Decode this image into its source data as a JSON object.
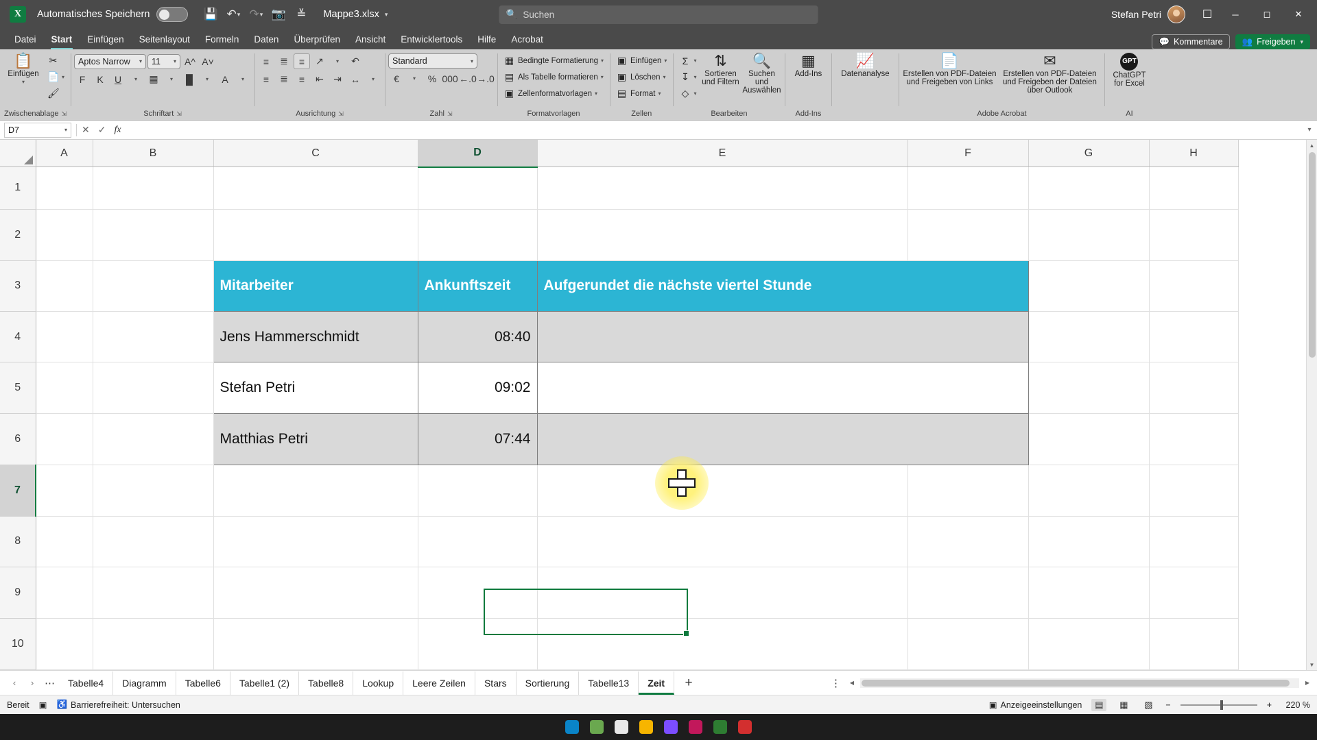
{
  "titlebar": {
    "autosave_label": "Automatisches Speichern",
    "autosave_state": "off",
    "save_icon": "save-icon",
    "undo_icon": "undo-icon",
    "redo_icon": "redo-icon",
    "camera_icon": "camera-icon",
    "customize_icon": "chevron-down-icon",
    "filename": "Mappe3.xlsx",
    "search_placeholder": "Suchen",
    "user_name": "Stefan Petri",
    "minimize": "minimize-icon",
    "maximize": "maximize-icon",
    "close": "close-icon"
  },
  "ribbon_tabs": [
    {
      "label": "Datei",
      "active": false
    },
    {
      "label": "Start",
      "active": true
    },
    {
      "label": "Einfügen",
      "active": false
    },
    {
      "label": "Seitenlayout",
      "active": false
    },
    {
      "label": "Formeln",
      "active": false
    },
    {
      "label": "Daten",
      "active": false
    },
    {
      "label": "Überprüfen",
      "active": false
    },
    {
      "label": "Ansicht",
      "active": false
    },
    {
      "label": "Entwicklertools",
      "active": false
    },
    {
      "label": "Hilfe",
      "active": false
    },
    {
      "label": "Acrobat",
      "active": false
    }
  ],
  "ribbon_right": {
    "comments_label": "Kommentare",
    "share_label": "Freigeben"
  },
  "ribbon": {
    "clipboard": {
      "group_label": "Zwischenablage",
      "paste_label": "Einfügen",
      "cut_label": "Ausschneiden",
      "copy_label": "Kopieren",
      "format_painter_label": "Format übertragen"
    },
    "font": {
      "group_label": "Schriftart",
      "font_name": "Aptos Narrow",
      "font_size": "11",
      "grow_label": "Schriftgrad vergrößern",
      "shrink_label": "Schriftgrad verkleinern",
      "bold_label": "F",
      "italic_label": "K",
      "underline_label": "U",
      "borders_label": "Rahmen",
      "fill_label": "Füllfarbe",
      "fontcolor_label": "Schriftfarbe"
    },
    "alignment": {
      "group_label": "Ausrichtung",
      "wrap_label": "Textumbruch",
      "merge_label": "Verbinden und zentrieren"
    },
    "number": {
      "group_label": "Zahl",
      "format_value": "Standard",
      "currency_label": "Buchhaltungszahlenformat",
      "percent_label": "Prozentformat",
      "thousands_label": "1000er-Trennzeichen",
      "inc_dec_label": "Dezimalstelle hinzufügen",
      "dec_dec_label": "Dezimalstelle löschen"
    },
    "styles": {
      "group_label": "Formatvorlagen",
      "items": [
        "Bedingte Formatierung",
        "Als Tabelle formatieren",
        "Zellenformatvorlagen"
      ]
    },
    "cells": {
      "group_label": "Zellen",
      "items": [
        "Einfügen",
        "Löschen",
        "Format"
      ]
    },
    "editing": {
      "group_label": "Bearbeiten",
      "autosum_label": "AutoSumme",
      "fill_label": "Füllbereich",
      "clear_label": "Löschen",
      "sort_label": "Sortieren und Filtern",
      "find_label": "Suchen und Auswählen"
    },
    "addins": {
      "group_label": "Add-Ins",
      "button_label": "Add-Ins",
      "analysis_label": "Datenanalyse"
    },
    "acrobat": {
      "group_label": "Adobe Acrobat",
      "items": [
        "Erstellen von PDF-Dateien und Freigeben von Links",
        "Erstellen von PDF-Dateien und Freigeben der Dateien über Outlook"
      ]
    },
    "ai": {
      "group_label": "AI",
      "button_label": "ChatGPT for Excel",
      "badge": "GPT"
    }
  },
  "formulabar": {
    "namebox_value": "D7",
    "cancel_icon": "close-icon",
    "confirm_icon": "check-icon",
    "fx_icon": "function-icon",
    "formula_value": "",
    "expand_icon": "chevron-down-icon"
  },
  "grid": {
    "columns": [
      "A",
      "B",
      "C",
      "D",
      "E",
      "F",
      "G",
      "H"
    ],
    "selected_column": "D",
    "rows": [
      "1",
      "2",
      "3",
      "4",
      "5",
      "6",
      "7",
      "8",
      "9",
      "10"
    ],
    "selected_row": "7",
    "active_cell": "D7",
    "table": {
      "headers": [
        "Mitarbeiter",
        "Ankunftszeit",
        "Aufgerundet die nächste viertel Stunde"
      ],
      "header_color": "#2cb5d4",
      "rows": [
        {
          "mitarbeiter": "Jens Hammerschmidt",
          "ankunftszeit": "08:40",
          "aufgerundet": ""
        },
        {
          "mitarbeiter": "Stefan Petri",
          "ankunftszeit": "09:02",
          "aufgerundet": ""
        },
        {
          "mitarbeiter": "Matthias Petri",
          "ankunftszeit": "07:44",
          "aufgerundet": ""
        }
      ]
    }
  },
  "sheettabs": {
    "prev_icon": "chevron-left-icon",
    "next_icon": "chevron-right-icon",
    "more_icon": "ellipsis-icon",
    "add_icon": "plus-icon",
    "tabs": [
      {
        "label": "Tabelle4",
        "active": false
      },
      {
        "label": "Diagramm",
        "active": false
      },
      {
        "label": "Tabelle6",
        "active": false
      },
      {
        "label": "Tabelle1 (2)",
        "active": false
      },
      {
        "label": "Tabelle8",
        "active": false
      },
      {
        "label": "Lookup",
        "active": false
      },
      {
        "label": "Leere Zeilen",
        "active": false
      },
      {
        "label": "Stars",
        "active": false
      },
      {
        "label": "Sortierung",
        "active": false
      },
      {
        "label": "Tabelle13",
        "active": false
      },
      {
        "label": "Zeit",
        "active": true
      }
    ]
  },
  "statusbar": {
    "status": "Bereit",
    "macro_icon": "record-macro-icon",
    "accessibility": "Barrierefreiheit: Untersuchen",
    "display_settings": "Anzeigeeinstellungen",
    "view_normal": "normal-view-icon",
    "view_pagelayout": "page-layout-icon",
    "view_pagebreak": "page-break-icon",
    "zoom_out": "zoom-out-icon",
    "zoom_in": "zoom-in-icon",
    "zoom_level": "220 %"
  }
}
